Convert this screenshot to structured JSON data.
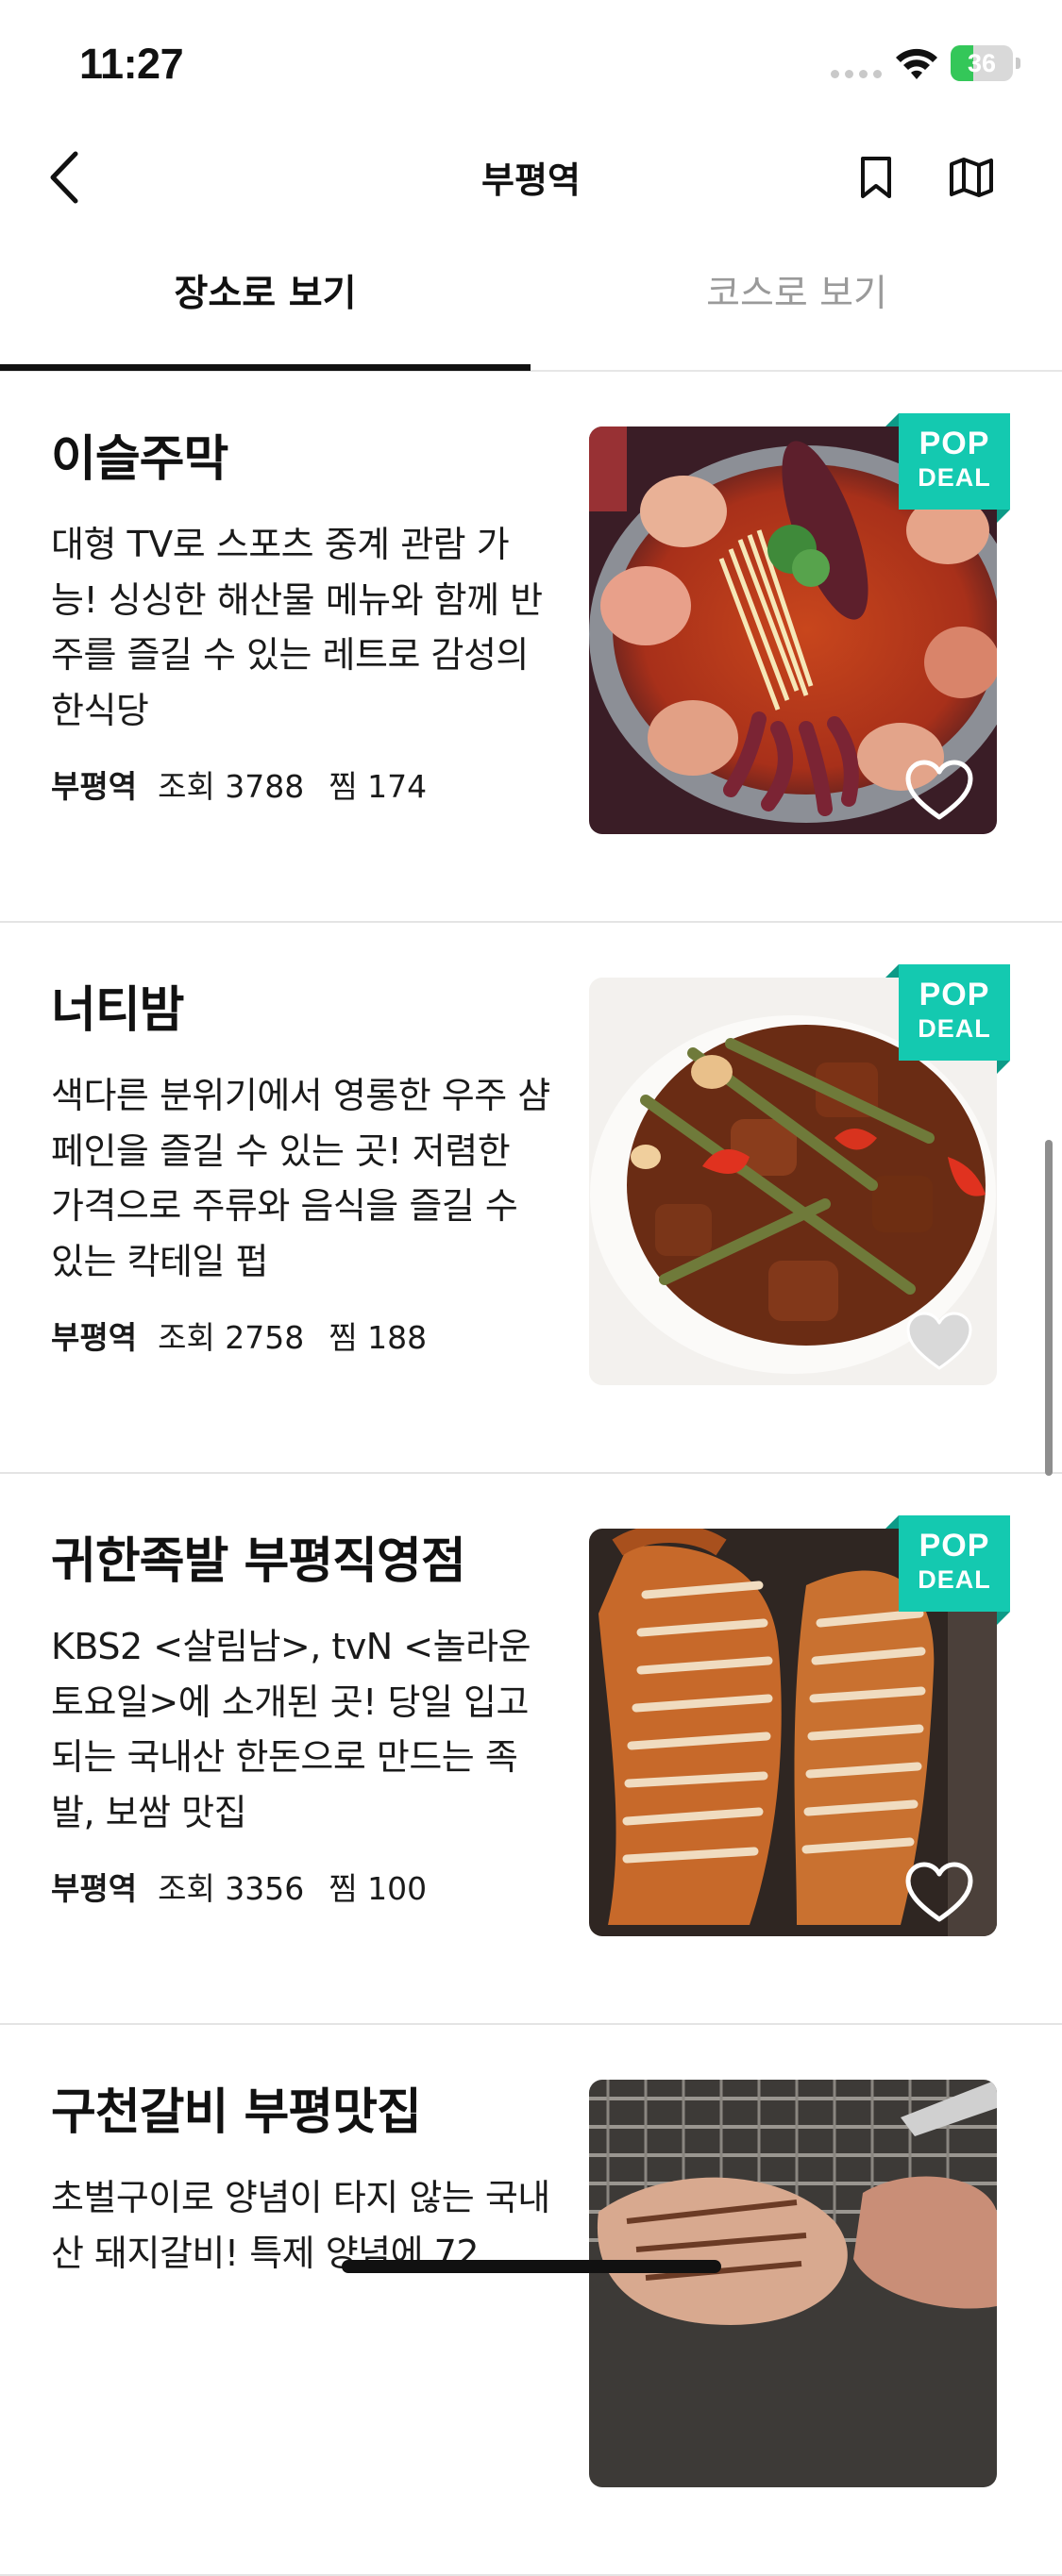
{
  "status_bar": {
    "time": "11:27",
    "battery": "36",
    "battery_level": 0.36
  },
  "nav": {
    "title": "부평역"
  },
  "tabs": [
    {
      "label": "장소로 보기",
      "active": true
    },
    {
      "label": "코스로 보기",
      "active": false
    }
  ],
  "items": [
    {
      "name": "이슬주막",
      "description": "대형 TV로 스포츠 중계 관람 가능! 싱싱한 해산물 메뉴와 함께 반주를 즐길 수 있는 레트로 감성의 한식당",
      "station": "부평역",
      "views": "조회 3788",
      "saves": "찜 174",
      "deal_line1": "POP",
      "deal_line2": "DEAL",
      "image_icon": "seafood-stew-photo"
    },
    {
      "name": "너티밤",
      "description": "색다른 분위기에서 영롱한 우주 샴페인을 즐길 수 있는 곳! 저렴한 가격으로 주류와 음식을 즐길 수 있는 칵테일 펍",
      "station": "부평역",
      "views": "조회 2758",
      "saves": "찜 188",
      "deal_line1": "POP",
      "deal_line2": "DEAL",
      "image_icon": "stir-fry-photo"
    },
    {
      "name": "귀한족발 부평직영점",
      "description": "KBS2 <살림남>, tvN <놀라운 토요일>에 소개된 곳! 당일 입고되는 국내산 한돈으로 만드는 족발, 보쌈 맛집",
      "station": "부평역",
      "views": "조회 3356",
      "saves": "찜 100",
      "deal_line1": "POP",
      "deal_line2": "DEAL",
      "image_icon": "jokbal-photo"
    },
    {
      "name": "구천갈비 부평맛집",
      "description": "초벌구이로 양념이 타지 않는 국내산 돼지갈비! 특제 양념에 72",
      "station": "",
      "views": "",
      "saves": "",
      "deal_line1": "",
      "deal_line2": "",
      "image_icon": "grilled-galbi-photo"
    }
  ],
  "colors": {
    "deal_badge": "#14c9b0",
    "active_tab": "#111111",
    "inactive_tab": "#9a9a9a"
  }
}
